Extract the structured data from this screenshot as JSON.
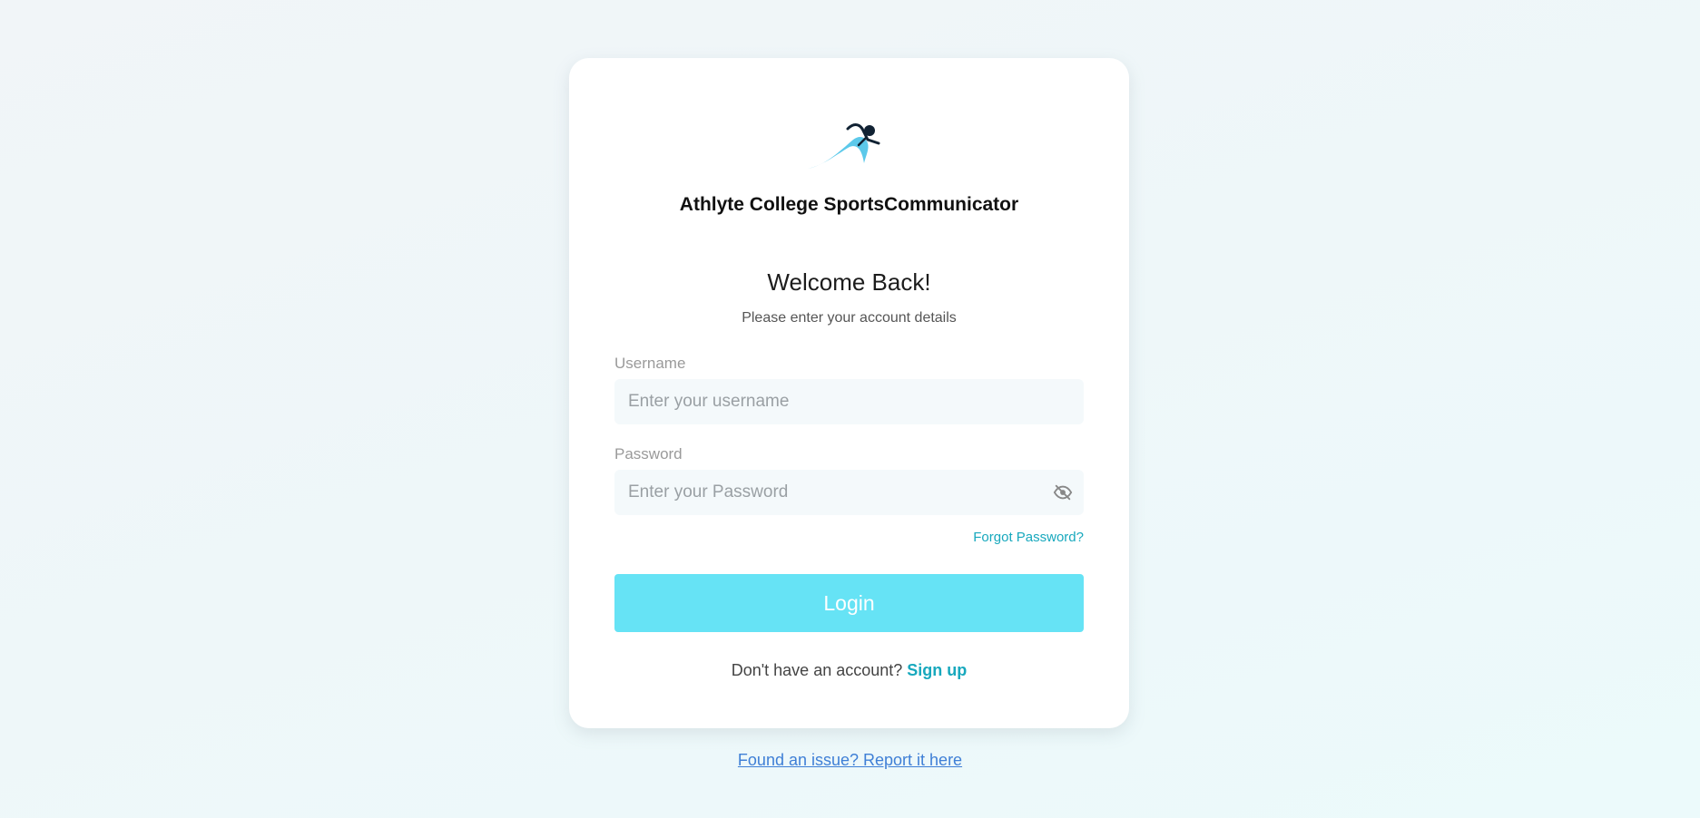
{
  "app": {
    "name": "Athlyte College SportsCommunicator",
    "logo_icon": "runner-logo-icon"
  },
  "login": {
    "heading": "Welcome Back!",
    "subtitle": "Please enter your account details",
    "username_label": "Username",
    "username_placeholder": "Enter your username",
    "username_value": "",
    "password_label": "Password",
    "password_placeholder": "Enter your Password",
    "password_value": "",
    "password_toggle_icon": "eye-off-icon",
    "forgot_password": "Forgot Password?",
    "login_button": "Login",
    "signup_prompt": "Don't have an account?",
    "signup_link": "Sign up"
  },
  "footer": {
    "report_link": "Found an issue? Report it here"
  },
  "colors": {
    "accent": "#17a8bd",
    "button": "#66e3f5",
    "link": "#3f7fd6"
  }
}
